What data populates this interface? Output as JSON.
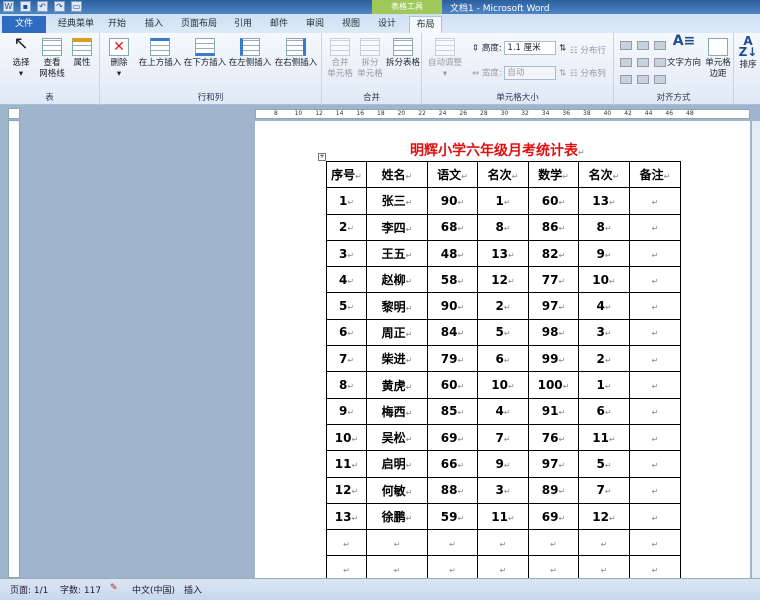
{
  "window": {
    "title": "文档1 - Microsoft Word",
    "context_tab": "表格工具"
  },
  "tabs": [
    "文件",
    "经典菜单",
    "开始",
    "插入",
    "页面布局",
    "引用",
    "邮件",
    "审阅",
    "视图",
    "设计",
    "布局"
  ],
  "ribbon": {
    "table_group": {
      "label": "表",
      "select": "选择",
      "gridlines": [
        "查看",
        "网格线"
      ],
      "props": "属性"
    },
    "rows_cols": {
      "label": "行和列",
      "delete": "删除",
      "above": "在上方插入",
      "below": "在下方插入",
      "left": "在左侧插入",
      "right": "在右侧插入"
    },
    "merge": {
      "label": "合并",
      "merge": [
        "合并",
        "单元格"
      ],
      "split": [
        "拆分",
        "单元格"
      ],
      "split_table": "拆分表格"
    },
    "cell_size": {
      "label": "单元格大小",
      "autofit": "自动调整",
      "height_label": "高度:",
      "height_value": "1.1 厘米",
      "width_label": "宽度:",
      "width_value": "自动",
      "dist_rows": "分布行",
      "dist_cols": "分布列"
    },
    "align": {
      "label": "对齐方式",
      "text_dir": "文字方向",
      "margins": [
        "单元格",
        "边距"
      ]
    },
    "sort": "排序"
  },
  "ruler": [
    "8",
    "10",
    "12",
    "14",
    "16",
    "18",
    "20",
    "22",
    "24",
    "26",
    "28",
    "30",
    "32",
    "34",
    "36",
    "38",
    "40",
    "42",
    "44",
    "46",
    "48"
  ],
  "document": {
    "title": "明辉小学六年级月考统计表",
    "headers": [
      "序号",
      "姓名",
      "语文",
      "名次",
      "数学",
      "名次",
      "备注"
    ],
    "rows": [
      [
        "1",
        "张三",
        "90",
        "1",
        "60",
        "13",
        ""
      ],
      [
        "2",
        "李四",
        "68",
        "8",
        "86",
        "8",
        ""
      ],
      [
        "3",
        "王五",
        "48",
        "13",
        "82",
        "9",
        ""
      ],
      [
        "4",
        "赵柳",
        "58",
        "12",
        "77",
        "10",
        ""
      ],
      [
        "5",
        "黎明",
        "90",
        "2",
        "97",
        "4",
        ""
      ],
      [
        "6",
        "周正",
        "84",
        "5",
        "98",
        "3",
        ""
      ],
      [
        "7",
        "柴进",
        "79",
        "6",
        "99",
        "2",
        ""
      ],
      [
        "8",
        "黄虎",
        "60",
        "10",
        "100",
        "1",
        ""
      ],
      [
        "9",
        "梅西",
        "85",
        "4",
        "91",
        "6",
        ""
      ],
      [
        "10",
        "吴松",
        "69",
        "7",
        "76",
        "11",
        ""
      ],
      [
        "11",
        "启明",
        "66",
        "9",
        "97",
        "5",
        ""
      ],
      [
        "12",
        "何敏",
        "88",
        "3",
        "89",
        "7",
        ""
      ],
      [
        "13",
        "徐鹏",
        "59",
        "11",
        "69",
        "12",
        ""
      ],
      [
        "",
        "",
        "",
        "",
        "",
        "",
        ""
      ],
      [
        "",
        "",
        "",
        "",
        "",
        "",
        ""
      ]
    ]
  },
  "status": {
    "page": "页面: 1/1",
    "words": "字数: 117",
    "lang": "中文(中国)",
    "mode": "插入"
  }
}
